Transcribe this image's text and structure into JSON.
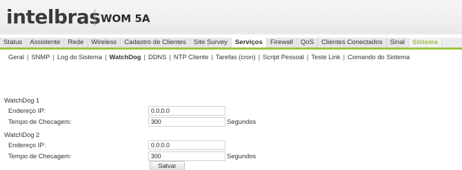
{
  "header": {
    "brand": "intelbras",
    "model": "WOM 5A"
  },
  "nav": {
    "tabs": [
      {
        "label": "Status",
        "state": ""
      },
      {
        "label": "Assistente",
        "state": ""
      },
      {
        "label": "Rede",
        "state": ""
      },
      {
        "label": "Wireless",
        "state": ""
      },
      {
        "label": "Cadastro de Clientes",
        "state": ""
      },
      {
        "label": "Site Survey",
        "state": ""
      },
      {
        "label": "Serviços",
        "state": "active"
      },
      {
        "label": "Firewall",
        "state": ""
      },
      {
        "label": "QoS",
        "state": ""
      },
      {
        "label": "Clientes Conectados",
        "state": ""
      },
      {
        "label": "Sinal",
        "state": ""
      },
      {
        "label": "Sistema",
        "state": "green"
      }
    ]
  },
  "subnav": {
    "items": [
      "Geral",
      "SNMP",
      "Log do Sistema",
      "WatchDog",
      "DDNS",
      "NTP Cliente",
      "Tarefas (cron)",
      "Script Pessoal",
      "Teste Link",
      "Comando do Sistema"
    ],
    "active_index": 3,
    "separator": "|"
  },
  "watchdog1": {
    "title": "WatchDog 1",
    "ip_label": "Endereço IP:",
    "ip_value": "0.0.0.0",
    "interval_label": "Tempo de Checagem:",
    "interval_value": "300",
    "unit": "Segundos"
  },
  "watchdog2": {
    "title": "WatchDog 2",
    "ip_label": "Endereço IP:",
    "ip_value": "0.0.0.0",
    "interval_label": "Tempo de Checagem:",
    "interval_value": "300",
    "unit": "Segundos"
  },
  "actions": {
    "save_label": "Salvar"
  },
  "colors": {
    "accent_green": "#9bc53d",
    "header_bg": "#ececec"
  }
}
